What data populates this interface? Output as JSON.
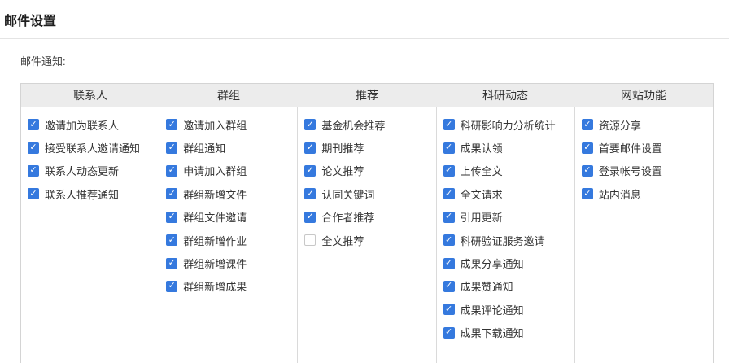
{
  "page": {
    "title": "邮件设置"
  },
  "section": {
    "label": "邮件通知:"
  },
  "table": {
    "columns": [
      {
        "header": "联系人",
        "items": [
          {
            "label": "邀请加为联系人",
            "checked": true
          },
          {
            "label": "接受联系人邀请通知",
            "checked": true
          },
          {
            "label": "联系人动态更新",
            "checked": true
          },
          {
            "label": "联系人推荐通知",
            "checked": true
          }
        ]
      },
      {
        "header": "群组",
        "items": [
          {
            "label": "邀请加入群组",
            "checked": true
          },
          {
            "label": "群组通知",
            "checked": true
          },
          {
            "label": "申请加入群组",
            "checked": true
          },
          {
            "label": "群组新增文件",
            "checked": true
          },
          {
            "label": "群组文件邀请",
            "checked": true
          },
          {
            "label": "群组新增作业",
            "checked": true
          },
          {
            "label": "群组新增课件",
            "checked": true
          },
          {
            "label": "群组新增成果",
            "checked": true
          }
        ]
      },
      {
        "header": "推荐",
        "items": [
          {
            "label": "基金机会推荐",
            "checked": true
          },
          {
            "label": "期刊推荐",
            "checked": true
          },
          {
            "label": "论文推荐",
            "checked": true
          },
          {
            "label": "认同关键词",
            "checked": true
          },
          {
            "label": "合作者推荐",
            "checked": true
          },
          {
            "label": "全文推荐",
            "checked": false
          }
        ]
      },
      {
        "header": "科研动态",
        "items": [
          {
            "label": "科研影响力分析统计",
            "checked": true
          },
          {
            "label": "成果认领",
            "checked": true
          },
          {
            "label": "上传全文",
            "checked": true
          },
          {
            "label": "全文请求",
            "checked": true
          },
          {
            "label": "引用更新",
            "checked": true
          },
          {
            "label": "科研验证服务邀请",
            "checked": true
          },
          {
            "label": "成果分享通知",
            "checked": true
          },
          {
            "label": "成果赞通知",
            "checked": true
          },
          {
            "label": "成果评论通知",
            "checked": true
          },
          {
            "label": "成果下载通知",
            "checked": true
          }
        ]
      },
      {
        "header": "网站功能",
        "items": [
          {
            "label": "资源分享",
            "checked": true
          },
          {
            "label": "首要邮件设置",
            "checked": true
          },
          {
            "label": "登录帐号设置",
            "checked": true
          },
          {
            "label": "站内消息",
            "checked": true
          }
        ]
      }
    ]
  },
  "colors": {
    "checkbox_checked": "#3579de",
    "checkbox_unchecked_border": "#c8c8c8",
    "header_bg": "#ececec",
    "table_border": "#d4d4d4",
    "text": "#333333"
  }
}
